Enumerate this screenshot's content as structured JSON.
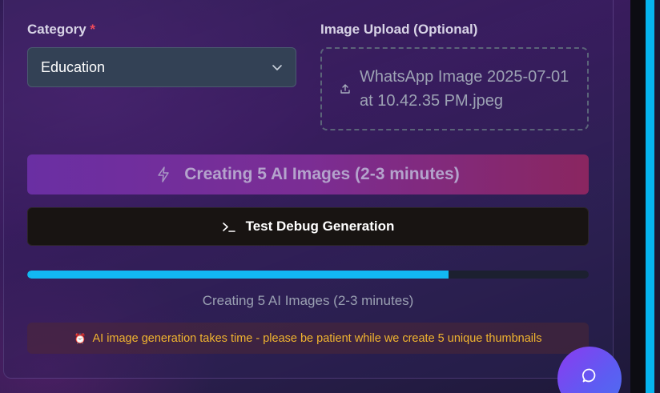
{
  "form": {
    "category_label": "Category",
    "required_mark": "*",
    "category_value": "Education",
    "upload_label": "Image Upload (Optional)",
    "upload_filename": "WhatsApp Image 2025-07-01 at 10.42.35 PM.jpeg",
    "generate_button_label": "Creating 5 AI Images (2-3 minutes)",
    "debug_button_label": "Test Debug Generation"
  },
  "progress": {
    "fraction": 0.75,
    "status_text": "Creating 5 AI Images (2-3 minutes)"
  },
  "notice": {
    "icon": "⏰",
    "text": "AI image generation takes time - please be patient while we create 5 unique thumbnails"
  },
  "icons": {
    "chevron": "chevron-down-icon",
    "upload": "upload-icon",
    "bolt": "lightning-bolt-icon",
    "terminal": "terminal-icon",
    "chat": "chat-bubble-icon"
  },
  "colors": {
    "progress": "#12b8f3",
    "required": "#ef4b5b",
    "notice_text": "#f1b42f",
    "accent_strip": "#06b4ef"
  }
}
